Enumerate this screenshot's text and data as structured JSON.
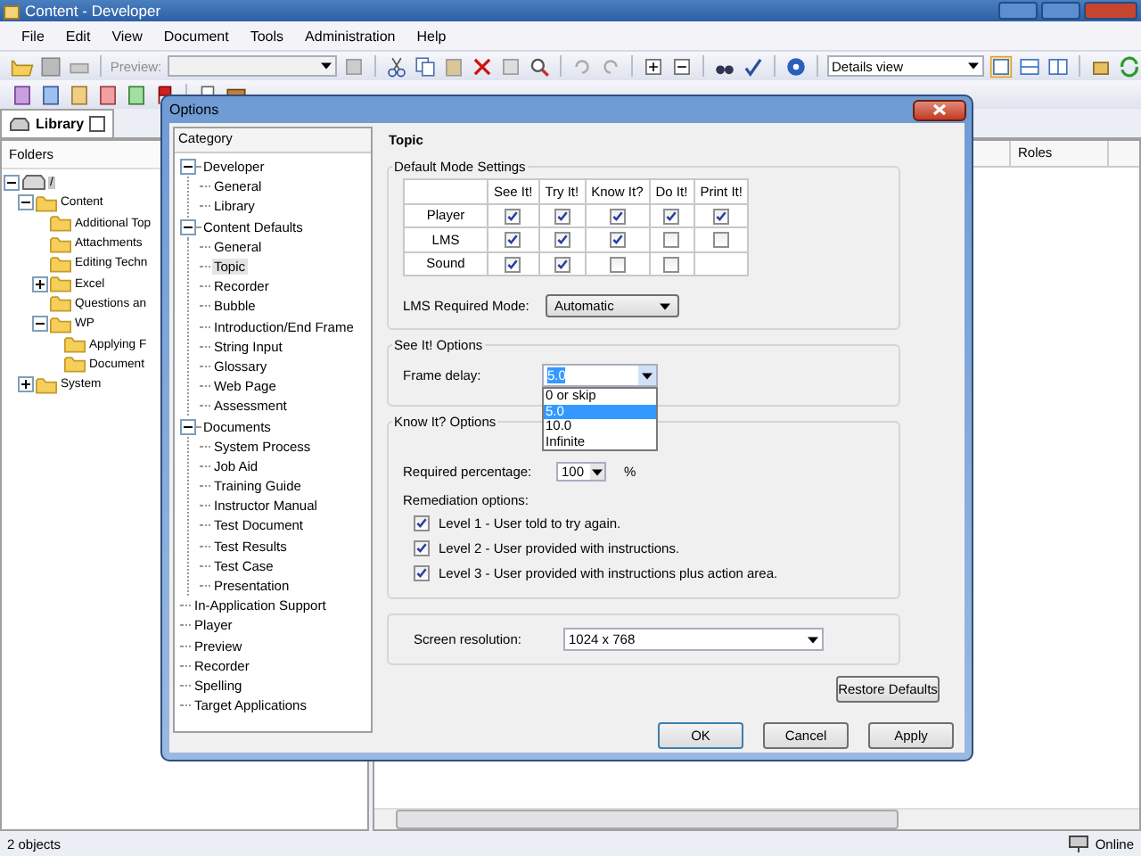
{
  "window": {
    "title": "Content - Developer"
  },
  "menu": [
    "File",
    "Edit",
    "View",
    "Document",
    "Tools",
    "Administration",
    "Help"
  ],
  "toolbar": {
    "preview_label": "Preview:",
    "view_select": "Details view"
  },
  "library_tab": {
    "label": "Library",
    "selected": true
  },
  "folders": {
    "heading": "Folders",
    "root": {
      "label": "/",
      "selected": true,
      "expanded": true,
      "children": [
        {
          "label": "Content",
          "selected": false,
          "expanded": true,
          "children": [
            {
              "label": "Additional Top",
              "selected": false
            },
            {
              "label": "Attachments",
              "selected": false
            },
            {
              "label": "Editing Techn",
              "selected": false
            },
            {
              "label": "Excel",
              "selected": false,
              "expanded": false
            },
            {
              "label": "Questions an",
              "selected": false
            },
            {
              "label": "WP",
              "selected": false,
              "expanded": true,
              "children": [
                {
                  "label": "Applying F",
                  "selected": false
                },
                {
                  "label": "Document",
                  "selected": false
                }
              ]
            }
          ]
        },
        {
          "label": "System",
          "selected": false,
          "expanded": false
        }
      ]
    }
  },
  "content_pane": {
    "columns": [
      "Roles"
    ]
  },
  "status_bar": {
    "count": "2 objects",
    "connection": "Online"
  },
  "dialog": {
    "title": "Options",
    "category_heading": "Category",
    "categories": [
      {
        "label": "Developer",
        "selected": false,
        "expanded": true,
        "children": [
          {
            "label": "General",
            "selected": false
          },
          {
            "label": "Library",
            "selected": false
          }
        ]
      },
      {
        "label": "Content Defaults",
        "selected": false,
        "expanded": true,
        "children": [
          {
            "label": "General",
            "selected": false
          },
          {
            "label": "Topic",
            "selected": true
          },
          {
            "label": "Recorder",
            "selected": false
          },
          {
            "label": "Bubble",
            "selected": false
          },
          {
            "label": "Introduction/End Frame",
            "selected": false
          },
          {
            "label": "String Input",
            "selected": false
          },
          {
            "label": "Glossary",
            "selected": false
          },
          {
            "label": "Web Page",
            "selected": false
          },
          {
            "label": "Assessment",
            "selected": false
          }
        ]
      },
      {
        "label": "Documents",
        "selected": false,
        "expanded": true,
        "children": [
          {
            "label": "System Process",
            "selected": false
          },
          {
            "label": "Job Aid",
            "selected": false
          },
          {
            "label": "Training Guide",
            "selected": false
          },
          {
            "label": "Instructor Manual",
            "selected": false
          },
          {
            "label": "Test Document",
            "selected": false
          },
          {
            "label": "Test Results",
            "selected": false
          },
          {
            "label": "Test Case",
            "selected": false
          },
          {
            "label": "Presentation",
            "selected": false
          }
        ]
      },
      {
        "label": "In-Application Support",
        "selected": false
      },
      {
        "label": "Player",
        "selected": false
      },
      {
        "label": "Preview",
        "selected": false
      },
      {
        "label": "Recorder",
        "selected": false
      },
      {
        "label": "Spelling",
        "selected": false
      },
      {
        "label": "Target Applications",
        "selected": false
      }
    ],
    "page_title": "Topic",
    "mode_settings": {
      "legend": "Default Mode Settings",
      "columns": [
        "See It!",
        "Try It!",
        "Know It?",
        "Do It!",
        "Print It!"
      ],
      "rows": [
        {
          "label": "Player",
          "checks": [
            true,
            true,
            true,
            true,
            true
          ]
        },
        {
          "label": "LMS",
          "checks": [
            true,
            true,
            true,
            false,
            false
          ]
        },
        {
          "label": "Sound",
          "checks": [
            true,
            true,
            false,
            false
          ]
        }
      ],
      "required_mode_label": "LMS Required Mode:",
      "required_mode_value": "Automatic"
    },
    "see_it": {
      "legend": "See It! Options",
      "frame_delay_label": "Frame delay:",
      "frame_delay_value": "5.0",
      "options": [
        {
          "label": "0 or skip",
          "selected": false
        },
        {
          "label": "5.0",
          "selected": true
        },
        {
          "label": "10.0",
          "selected": false
        },
        {
          "label": "Infinite",
          "selected": false
        }
      ]
    },
    "know_it": {
      "legend": "Know It? Options",
      "percentage_label": "Required percentage:",
      "percentage_value": "100",
      "percentage_unit": "%",
      "remediation_label": "Remediation options:",
      "levels": [
        {
          "label": "Level 1 - User told to try again.",
          "checked": true
        },
        {
          "label": "Level 2 - User provided with instructions.",
          "checked": true
        },
        {
          "label": "Level 3 - User provided with instructions plus action area.",
          "checked": true
        }
      ]
    },
    "resolution": {
      "label": "Screen resolution:",
      "value": "1024 x 768"
    },
    "buttons": {
      "restore": "Restore Defaults",
      "ok": "OK",
      "cancel": "Cancel",
      "apply": "Apply"
    }
  }
}
